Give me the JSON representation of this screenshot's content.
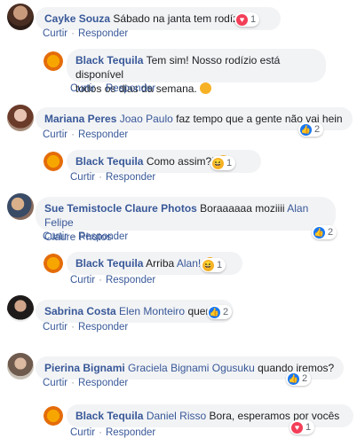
{
  "actions": {
    "curtir": "Curtir",
    "responder": "Responder"
  },
  "comments": [
    {
      "author": "Cayke Souza",
      "text": "Sábado na janta tem rodízio ?",
      "reaction_count": "1",
      "reply_author": "Black Tequila",
      "reply_line1": "Tem sim! Nosso rodízio está disponível",
      "reply_line2": "todos os dias da semana."
    },
    {
      "author": "Mariana Peres",
      "tag": "Joao Paulo",
      "text": "faz tempo que a gente não vai hein",
      "reaction_count": "2",
      "reply_author": "Black Tequila",
      "reply_text": "Como assim?!",
      "reply_reaction_count": "1"
    },
    {
      "author": "Sue Temistocle Claure Photos",
      "text": "Boraaaaaa moziiii",
      "tag_line1": "Alan Felipe",
      "tag_line2": "Claure Photos",
      "reaction_count": "2",
      "reply_author": "Black Tequila",
      "reply_text": "Arriba",
      "reply_tag": "Alan!",
      "reply_reaction_count": "1"
    },
    {
      "author": "Sabrina Costa",
      "tag": "Elen Monteiro",
      "text": "quero ir",
      "reaction_count": "2"
    },
    {
      "author": "Pierina Bignami",
      "tag": "Graciela Bignami Ogusuku",
      "text": "quando iremos?",
      "reaction_count": "2",
      "reply_author": "Black Tequila",
      "reply_tag": "Daniel Risso",
      "reply_text": "Bora, esperamos por vocês",
      "reply_reaction_count": "1"
    }
  ],
  "colors": {
    "link": "#385898",
    "bubble": "#f2f3f5",
    "like": "#1877f2",
    "love": "#f33e58",
    "haha": "#f7b125"
  },
  "icons": [
    "like-icon",
    "love-icon",
    "haha-icon",
    "wow-icon",
    "smile-emoji",
    "laugh-emoji"
  ]
}
